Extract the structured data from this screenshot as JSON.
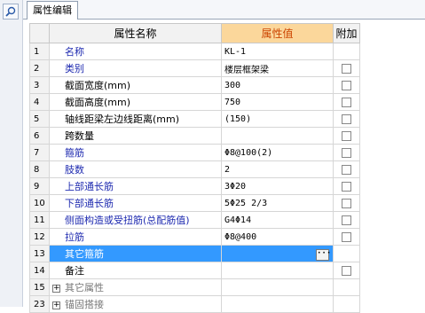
{
  "tab": {
    "label": "属性编辑"
  },
  "columns": {
    "name": "属性名称",
    "value": "属性值",
    "extra": "附加"
  },
  "rows": [
    {
      "num": "1",
      "name": "名称",
      "value": "KL-1",
      "color": "blue"
    },
    {
      "num": "2",
      "name": "类别",
      "value": "楼层框架梁",
      "color": "blue",
      "checked": false
    },
    {
      "num": "3",
      "name": "截面宽度(mm)",
      "value": "300",
      "color": "black",
      "checked": false
    },
    {
      "num": "4",
      "name": "截面高度(mm)",
      "value": "750",
      "color": "black",
      "checked": false
    },
    {
      "num": "5",
      "name": "轴线距梁左边线距离(mm)",
      "value": "(150)",
      "color": "black",
      "checked": false
    },
    {
      "num": "6",
      "name": "跨数量",
      "value": "",
      "color": "black",
      "checked": false
    },
    {
      "num": "7",
      "name": "箍筋",
      "value": "Φ8@100(2)",
      "color": "blue",
      "checked": false
    },
    {
      "num": "8",
      "name": "肢数",
      "value": "2",
      "color": "blue",
      "checked": false
    },
    {
      "num": "9",
      "name": "上部通长筋",
      "value": "3Φ20",
      "color": "blue",
      "checked": false
    },
    {
      "num": "10",
      "name": "下部通长筋",
      "value": "5Φ25 2/3",
      "color": "blue",
      "checked": false
    },
    {
      "num": "11",
      "name": "侧面构造或受扭筋(总配筋值)",
      "value": "G4Φ14",
      "color": "blue",
      "checked": false
    },
    {
      "num": "12",
      "name": "拉筋",
      "value": "Φ8@400",
      "color": "blue",
      "checked": false
    },
    {
      "num": "13",
      "name": "其它箍筋",
      "value": "",
      "color": "blue",
      "selected": true
    },
    {
      "num": "14",
      "name": "备注",
      "value": "",
      "color": "black",
      "checked": false
    },
    {
      "num": "15",
      "name": "其它属性",
      "value": "",
      "color": "gray",
      "expander": "+"
    },
    {
      "num": "23",
      "name": "锚固搭接",
      "value": "",
      "color": "gray",
      "expander": "+"
    }
  ],
  "colors": {
    "header_value_bg": "#fbd79b",
    "header_value_text": "#cc4400",
    "selection": "#3399ff",
    "label_blue": "#1f2bb0"
  }
}
